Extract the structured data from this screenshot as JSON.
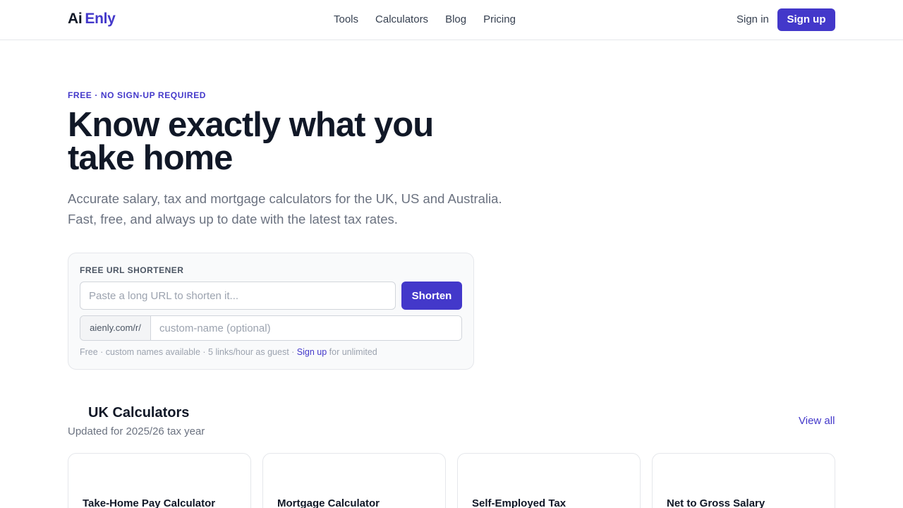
{
  "nav": {
    "logo_part1": "Ai",
    "logo_part2": "Enly",
    "links": [
      "Tools",
      "Calculators",
      "Blog",
      "Pricing"
    ],
    "signin": "Sign in",
    "signup": "Sign up"
  },
  "hero": {
    "eyebrow": "FREE · NO SIGN-UP REQUIRED",
    "headline": "Know exactly what you take home",
    "subhead": "Accurate salary, tax and mortgage calculators for the UK, US and Australia. Fast, free, and always up to date with the latest tax rates."
  },
  "shortener": {
    "label": "FREE URL SHORTENER",
    "url_placeholder": "Paste a long URL to shorten it...",
    "url_value": "",
    "button": "Shorten",
    "prefix": "aienly.com/r/",
    "custom_placeholder": "custom-name (optional)",
    "custom_value": "",
    "note_text": "Free · custom names available · 5 links/hour as guest · ",
    "note_link": "Sign up",
    "note_suffix": " for unlimited"
  },
  "uk_section": {
    "title": "UK Calculators",
    "subtitle": "Updated for 2025/26 tax year",
    "view_all": "View all",
    "cards": [
      {
        "title": "Take-Home Pay Calculator"
      },
      {
        "title": "Mortgage Calculator"
      },
      {
        "title": "Self-Employed Tax"
      },
      {
        "title": "Net to Gross Salary"
      }
    ]
  },
  "colors": {
    "accent": "#4338ca",
    "text_primary": "#111827",
    "text_muted": "#6b7280",
    "border": "#e5e7eb"
  }
}
